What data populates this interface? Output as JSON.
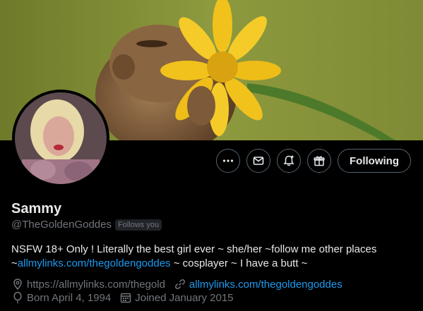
{
  "profile": {
    "display_name": "Sammy",
    "handle": "@TheGoldenGoddes",
    "follows_you_badge": "Follows you",
    "bio": {
      "line1": "NSFW 18+ Only ! Literally the best girl ever  ~ she/her ~follow me other places",
      "line2_prefix": "~",
      "line2_link": "allmylinks.com/thegoldengoddes",
      "line2_suffix": " ~ cosplayer ~ I have a butt ~"
    },
    "meta": {
      "location": "https://allmylinks.com/thegold",
      "website": "allmylinks.com/thegoldengoddes",
      "birthday": "Born April 4, 1994",
      "joined": "Joined January 2015"
    }
  },
  "actions": {
    "following_label": "Following"
  },
  "icons": {
    "more": "more-icon",
    "message": "message-icon",
    "notify": "notification-bell-icon",
    "subscribe": "gift-icon",
    "location": "location-pin-icon",
    "link": "link-icon",
    "birthday": "balloon-icon",
    "calendar": "calendar-icon"
  },
  "colors": {
    "background": "#000000",
    "text": "#e7e9ea",
    "muted": "#71767b",
    "link": "#1d9bf0",
    "border": "#536471"
  }
}
